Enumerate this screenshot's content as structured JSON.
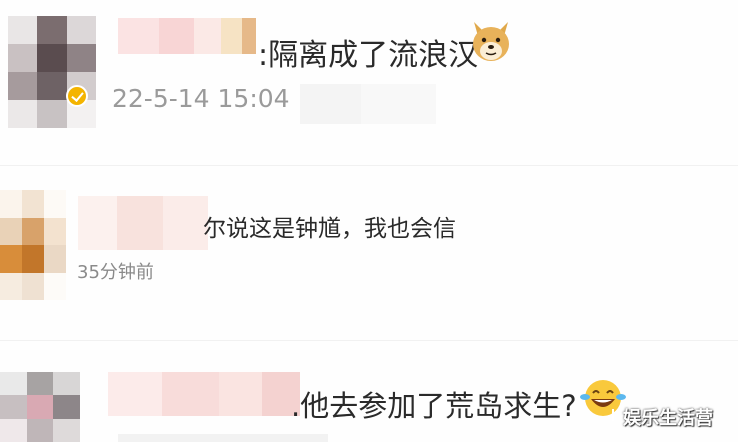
{
  "comments": [
    {
      "text": ":隔离成了流浪汉",
      "time": "22-5-14 15:04",
      "emoji": "doge-icon",
      "verified": true
    },
    {
      "text": "尔说这是钟馗，我也会信",
      "time": "35分钟前"
    },
    {
      "text": ".他去参加了荒岛求生?",
      "emoji": "laughing-tears-icon"
    }
  ],
  "watermark": "娱乐生活营",
  "colors": {
    "text": "#2a2a2a",
    "timestamp": "#8e8e8e",
    "verified_badge": "#f4b400",
    "background": "#fefefe"
  }
}
